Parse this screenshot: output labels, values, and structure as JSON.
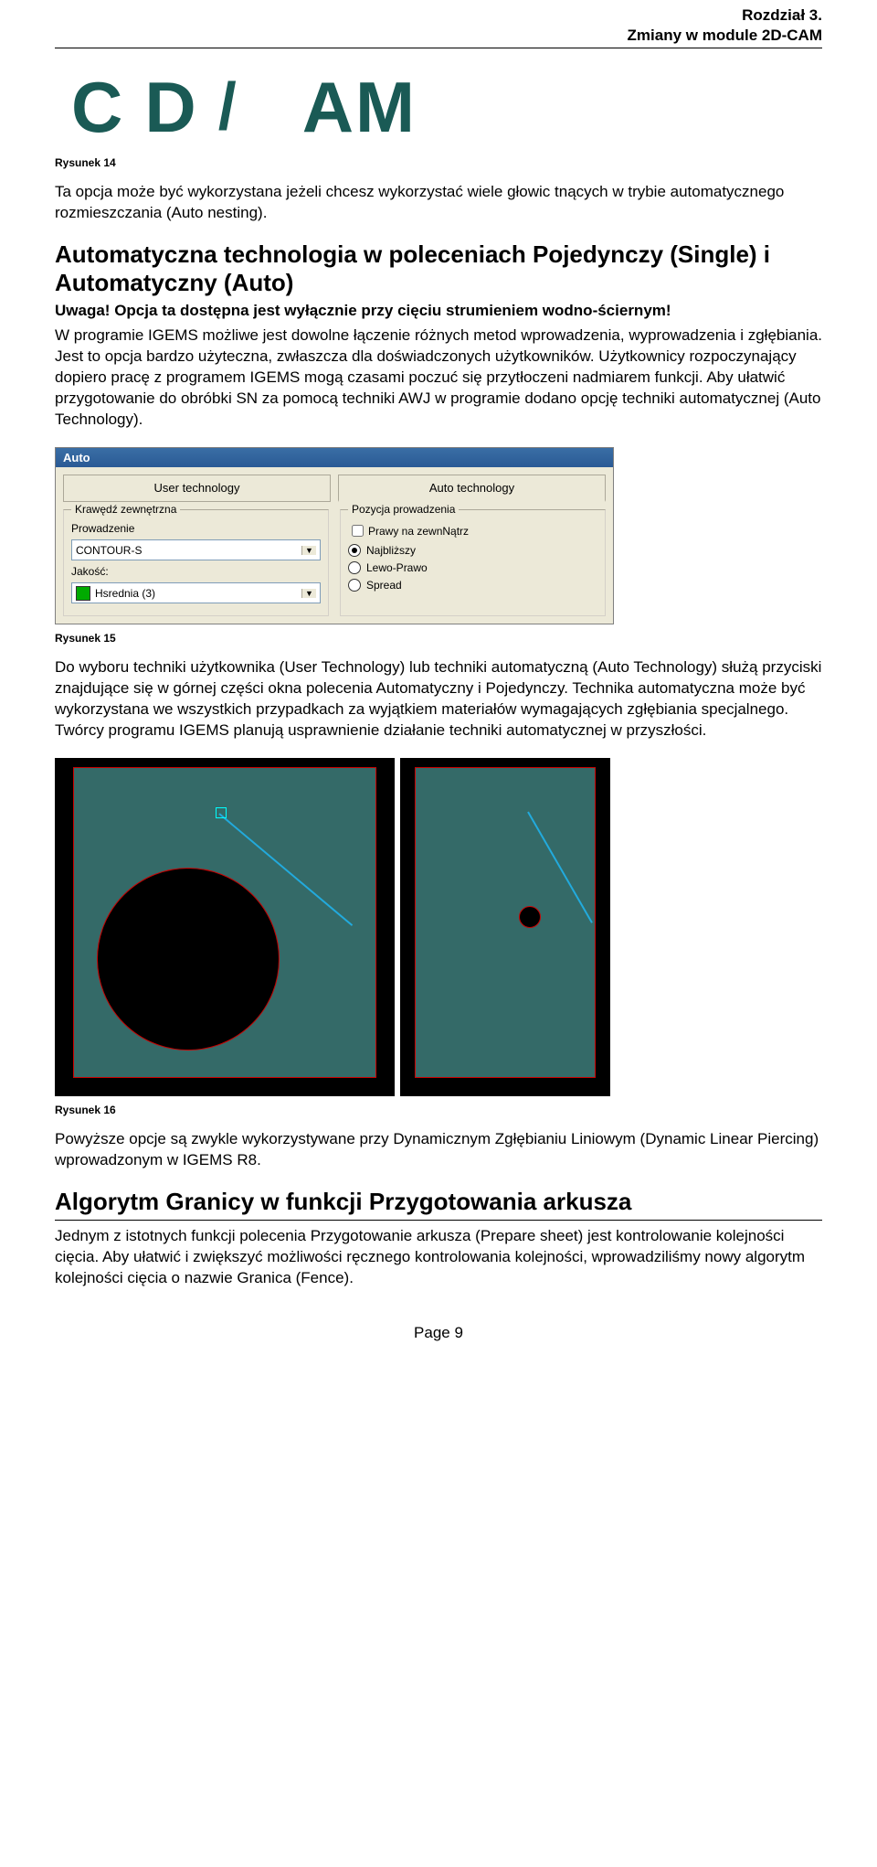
{
  "header": {
    "chapter": "Rozdział 3.",
    "title": "Zmiany w module 2D-CAM"
  },
  "banner": {
    "c": "C",
    "d": "D",
    "slash": "/",
    "am": "AM"
  },
  "fig14_caption": "Rysunek 14",
  "para1": "Ta opcja może być wykorzystana jeżeli chcesz wykorzystać wiele głowic tnących w trybie automatycznego rozmieszczania (Auto nesting).",
  "heading1": "Automatyczna technologia w poleceniach Pojedynczy (Single) i Automatyczny (Auto)",
  "warning_label": "Uwaga!",
  "warning_text": "Opcja ta dostępna jest wyłącznie przy cięciu strumieniem wodno-ściernym!",
  "para2": "W programie IGEMS możliwe jest dowolne łączenie różnych metod wprowadzenia, wyprowadzenia i zgłębiania. Jest to opcja bardzo użyteczna, zwłaszcza dla doświadczonych użytkowników. Użytkownicy rozpoczynający dopiero pracę z programem IGEMS mogą czasami poczuć się przytłoczeni nadmiarem funkcji. Aby ułatwić przygotowanie do obróbki SN za pomocą techniki AWJ w programie dodano opcję techniki automatycznej (Auto Technology).",
  "dialog": {
    "title": "Auto",
    "tab_user": "User technology",
    "tab_auto": "Auto technology",
    "group_left": "Krawędź zewnętrzna",
    "label_prowadzenie": "Prowadzenie",
    "select_contour": "CONTOUR-S",
    "label_jakosc": "Jakość:",
    "select_jakosc": "Hsrednia (3)",
    "group_right": "Pozycja prowadzenia",
    "chk_prawy": "Prawy na zewnNątrz",
    "rad_najblizszy": "Najbliższy",
    "rad_lewoprawo": "Lewo-Prawo",
    "rad_spread": "Spread"
  },
  "fig15_caption": "Rysunek 15",
  "para3": "Do wyboru techniki użytkownika (User Technology) lub techniki automatyczną (Auto Technology) służą przyciski znajdujące się w górnej części okna polecenia Automatyczny i Pojedynczy. Technika automatyczna może być wykorzystana we wszystkich przypadkach za wyjątkiem materiałów wymagających zgłębiania specjalnego. Twórcy programu IGEMS planują usprawnienie działanie techniki automatycznej w przyszłości.",
  "fig16_caption": "Rysunek 16",
  "para4": "Powyższe opcje są zwykle wykorzystywane przy Dynamicznym Zgłębianiu Liniowym (Dynamic Linear Piercing) wprowadzonym w IGEMS R8.",
  "heading2": "Algorytm Granicy w funkcji Przygotowania arkusza",
  "para5": "Jednym z istotnych funkcji polecenia Przygotowanie arkusza (Prepare sheet) jest kontrolowanie kolejności cięcia. Aby ułatwić i zwiększyć możliwości ręcznego kontrolowania kolejności, wprowadziliśmy nowy algorytm kolejności cięcia o nazwie Granica (Fence).",
  "footer": "Page 9"
}
